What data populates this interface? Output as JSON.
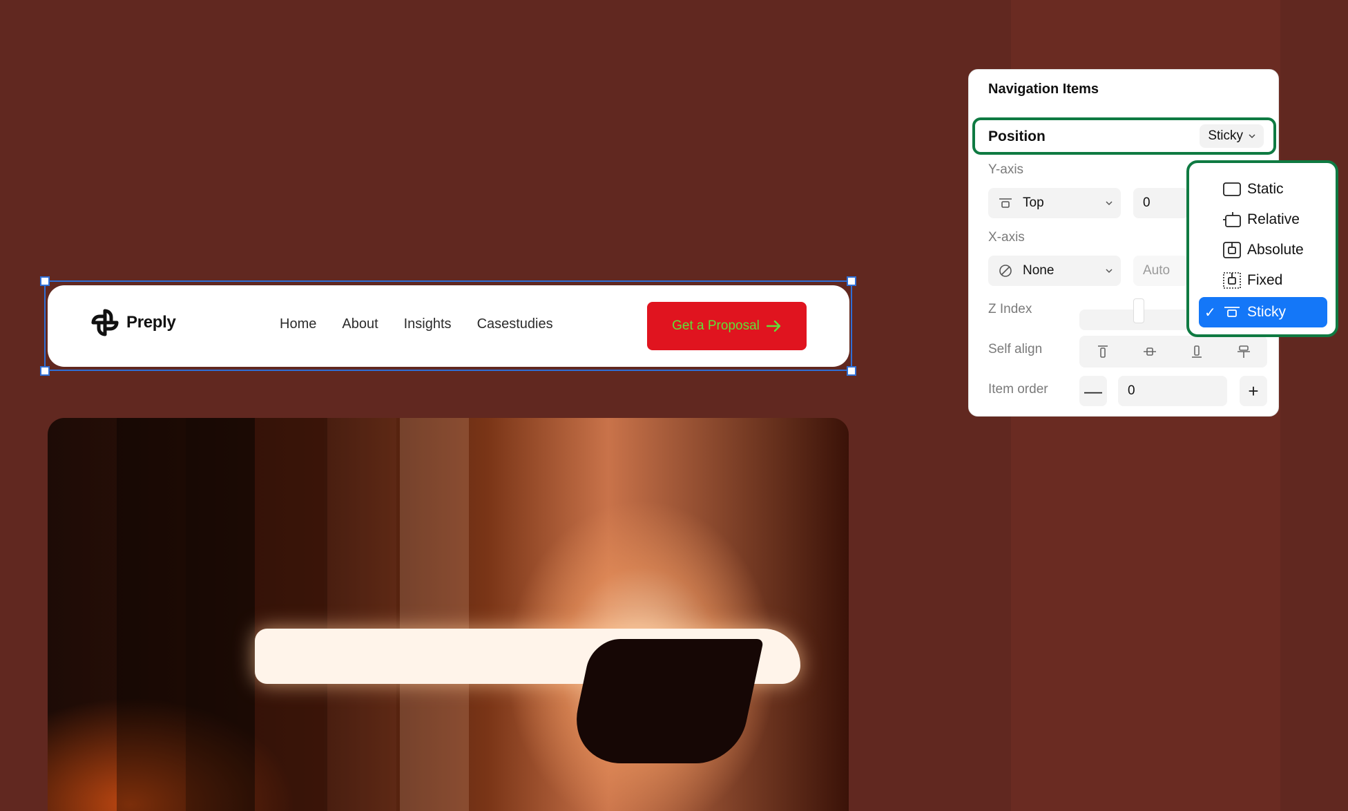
{
  "colors": {
    "background": "#612820",
    "accent_green": "#0f7a42",
    "cta_red": "#e0141f",
    "cta_text": "#5fe238",
    "selection_blue": "#1477f8"
  },
  "navbar": {
    "logo_text": "Preply",
    "links": [
      "Home",
      "About",
      "Insights",
      "Casestudies"
    ],
    "cta_label": "Get a Proposal"
  },
  "panel": {
    "title": "Navigation Items",
    "position": {
      "label": "Position",
      "value": "Sticky"
    },
    "y_axis": {
      "label": "Y-axis",
      "anchor": "Top",
      "value": "0"
    },
    "x_axis": {
      "label": "X-axis",
      "anchor": "None",
      "value": "Auto"
    },
    "z_index": {
      "label": "Z Index"
    },
    "self_align": {
      "label": "Self align",
      "icons": [
        "align-top-icon",
        "align-center-icon",
        "align-bottom-icon",
        "align-stretch-icon"
      ]
    },
    "item_order": {
      "label": "Item order",
      "value": "0",
      "minus": "—",
      "plus": "+"
    }
  },
  "dropdown": {
    "options": [
      "Static",
      "Relative",
      "Absolute",
      "Fixed",
      "Sticky"
    ],
    "selected": "Sticky",
    "check": "✓"
  }
}
